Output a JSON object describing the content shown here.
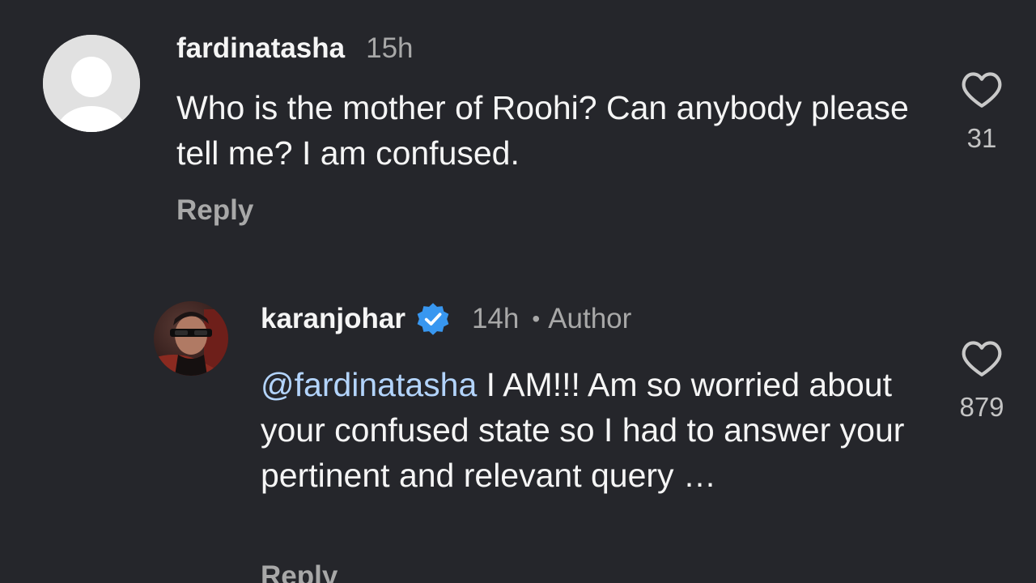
{
  "comments": [
    {
      "username": "fardinatasha",
      "time": "15h",
      "text": "Who is the mother of Roohi? Can anybody please tell me? I am confused.",
      "reply_label": "Reply",
      "likes": "31",
      "avatar_icon": "default-avatar-icon",
      "like_icon": "heart-outline-icon"
    },
    {
      "username": "karanjohar",
      "verified_icon": "verified-badge-icon",
      "verified_color": "#3897f0",
      "time": "14h",
      "separator": "•",
      "author_tag": "Author",
      "mention": "@fardinatasha",
      "text": " I AM!!! Am so worried about your confused state so I had to answer your pertinent and relevant query …",
      "reply_label": "Reply",
      "likes": "879",
      "avatar_icon": "profile-photo",
      "like_icon": "heart-outline-icon"
    }
  ],
  "colors": {
    "background": "#25262b",
    "text_primary": "#f5f5f5",
    "text_secondary": "#a8a8a8",
    "mention": "#b3d4fc"
  }
}
